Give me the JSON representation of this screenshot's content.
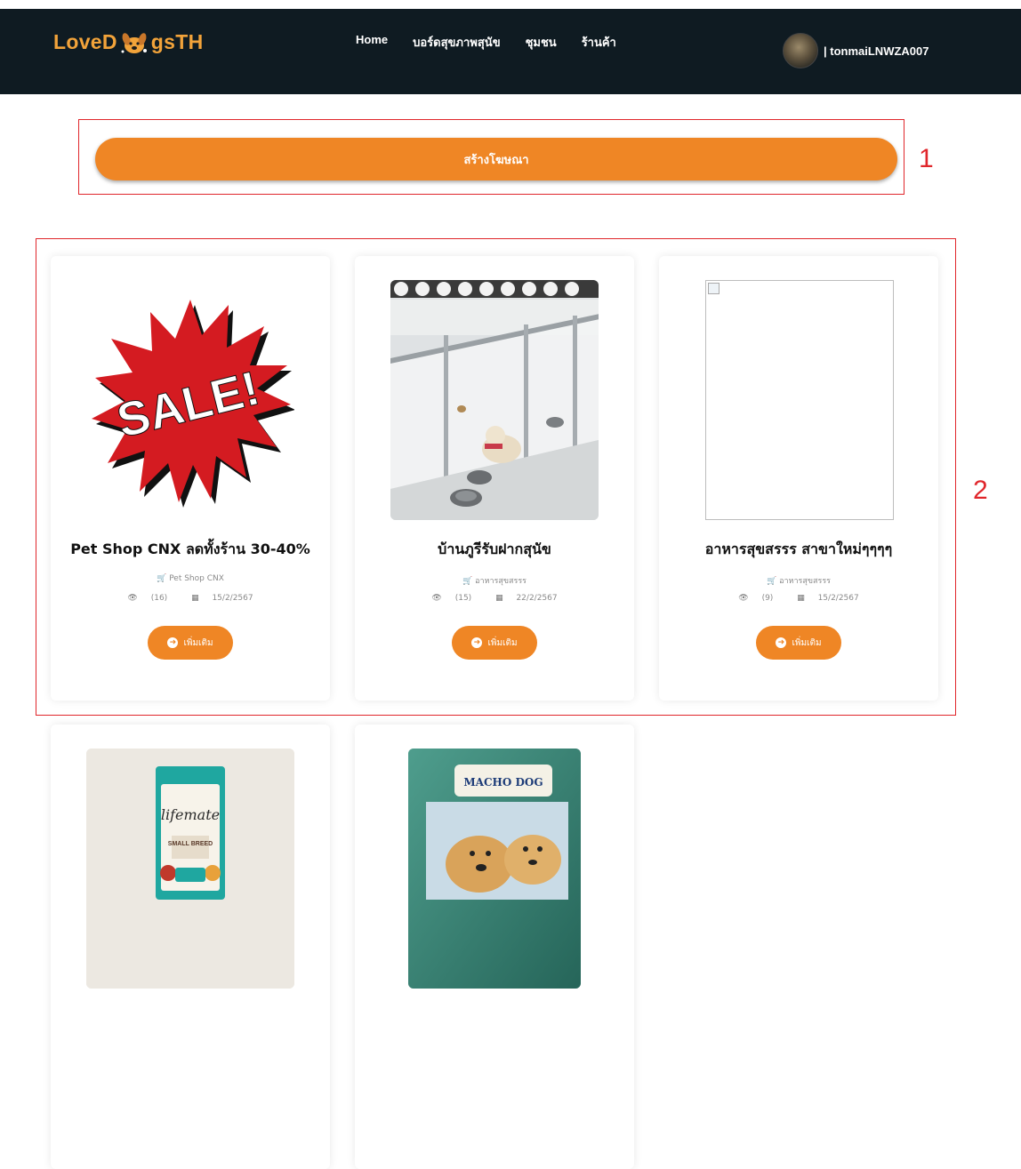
{
  "nav": {
    "logo_part1": "LoveD",
    "logo_part2": "gsTH",
    "links": [
      "Home",
      "บอร์ดสุขภาพสุนัข",
      "ชุมชน",
      "ร้านค้า"
    ],
    "user_label": "| tonmaiLNWZA007"
  },
  "create_ad": {
    "label": "สร้างโฆษณา"
  },
  "annotations": {
    "box1": "1",
    "box2": "2"
  },
  "cards": [
    {
      "title": "Pet Shop CNX ลดทั้งร้าน 30-40%",
      "shop": "Pet Shop CNX",
      "views": "(16)",
      "date": "15/2/2567",
      "button": "เพิ่มเติม",
      "image": "sale-burst"
    },
    {
      "title": "บ้านภูรีรับฝากสุนัข",
      "shop": "อาหารสุขสรรร",
      "views": "(15)",
      "date": "22/2/2567",
      "button": "เพิ่มเติม",
      "image": "kennel-photo"
    },
    {
      "title": "อาหารสุขสรรร สาขาใหม่ๆๆๆๆ",
      "shop": "อาหารสุขสรรร",
      "views": "(9)",
      "date": "15/2/2567",
      "button": "เพิ่มเติม",
      "image": "broken-image"
    },
    {
      "title": "",
      "image": "lifemate-bag",
      "brand": "lifemate",
      "brand_sub": "SMALL BREED"
    },
    {
      "title": "",
      "image": "macho-dog-bag",
      "brand": "MACHO DOG"
    }
  ],
  "icons": {
    "cart": "cart-icon",
    "eye": "eye-icon",
    "calendar": "calendar-icon",
    "arrow": "arrow-circle-right-icon"
  },
  "colors": {
    "accent": "#ef8625",
    "nav_bg": "#0f1b22",
    "logo": "#f2a33a",
    "annotation": "#e0262b"
  }
}
